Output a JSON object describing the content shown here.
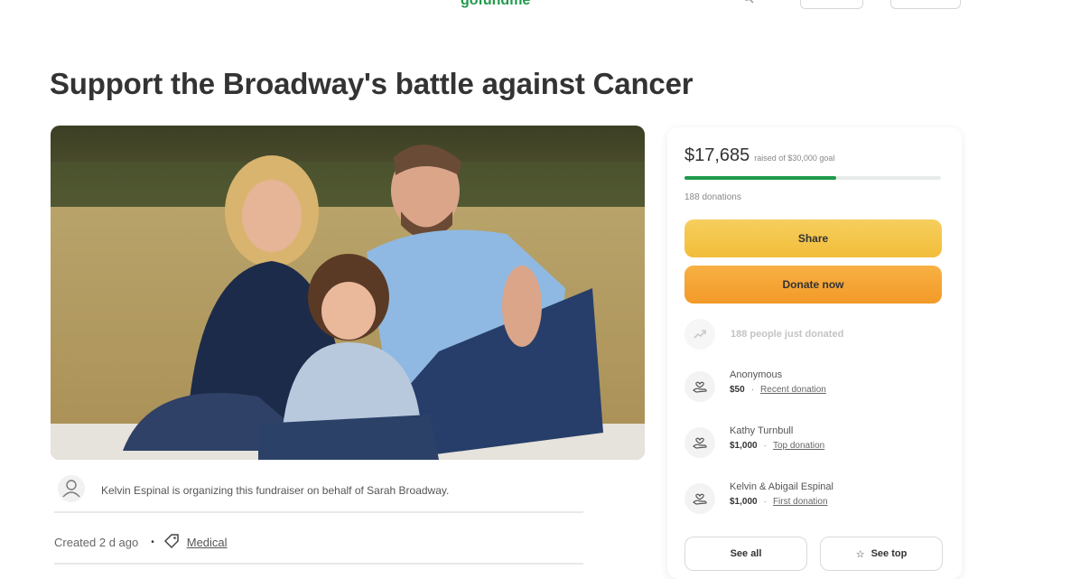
{
  "nav": {
    "left_text": "· · · ·",
    "logo": "gofundme"
  },
  "title": "Support the Broadway's battle against Cancer",
  "organizer": {
    "text": "Kelvin Espinal is organizing this fundraiser on behalf of Sarah Broadway."
  },
  "meta": {
    "created": "Created 2 d ago",
    "separator": "•",
    "category": "Medical"
  },
  "card": {
    "raised_amount": "$17,685",
    "goal_text": "raised of $30,000 goal",
    "progress": 0.59,
    "donation_count": "188 donations",
    "share_label": "Share",
    "donate_label": "Donate now",
    "trend_text": "188 people just donated",
    "donors": [
      {
        "name": "Anonymous",
        "amount": "$50",
        "kind": "Recent donation"
      },
      {
        "name": "Kathy Turnbull",
        "amount": "$1,000",
        "kind": "Top donation"
      },
      {
        "name": "Kelvin & Abigail Espinal",
        "amount": "$1,000",
        "kind": "First donation"
      }
    ],
    "see_all_label": "See all",
    "see_top_label": "See top"
  },
  "colors": {
    "brand_green": "#1f9a4b",
    "share_yellow": "#f2bd3a",
    "donate_orange": "#f29a28"
  },
  "icons": {
    "organizer": "user-icon",
    "category": "tag-icon",
    "trend": "trending-icon",
    "donor": "donor-hand-heart-icon",
    "see_top": "star-icon"
  }
}
